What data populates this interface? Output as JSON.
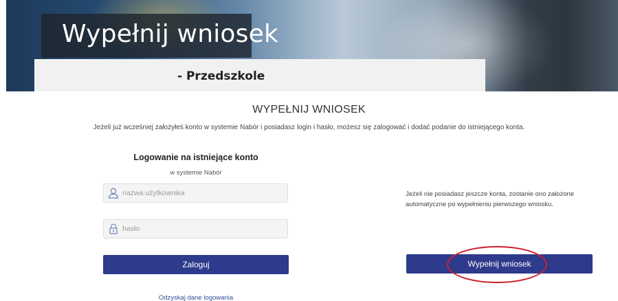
{
  "banner": {
    "title": "Wypełnij wniosek",
    "subtitle": "- Przedszkole"
  },
  "main": {
    "heading": "WYPEŁNIJ WNIOSEK",
    "intro": "Jeżeli już wcześniej założyłeś konto w systemie Nabór i posiadasz login i hasło, możesz się zalogować i dodać podanie do istniejącego konta."
  },
  "login": {
    "title": "Logowanie na istniejące konto",
    "subtitle": "w systemie Nabór",
    "username_placeholder": "nazwa użytkownika",
    "username_value": "",
    "password_placeholder": "hasło",
    "password_value": "",
    "submit_label": "Zaloguj",
    "recover_label": "Odzyskaj dane logowania"
  },
  "apply": {
    "info": "Jeżeli nie posiadasz jeszcze konta, zostanie ono założone automatyczne po wypełnieniu pierwszego wniosku.",
    "button_label": "Wypełnij wniosek"
  },
  "colors": {
    "primary_button": "#2e3a8c",
    "highlight_ellipse": "#d0202b",
    "link": "#2e4f9a"
  },
  "icons": {
    "username": "user-icon",
    "password": "lock-icon"
  }
}
